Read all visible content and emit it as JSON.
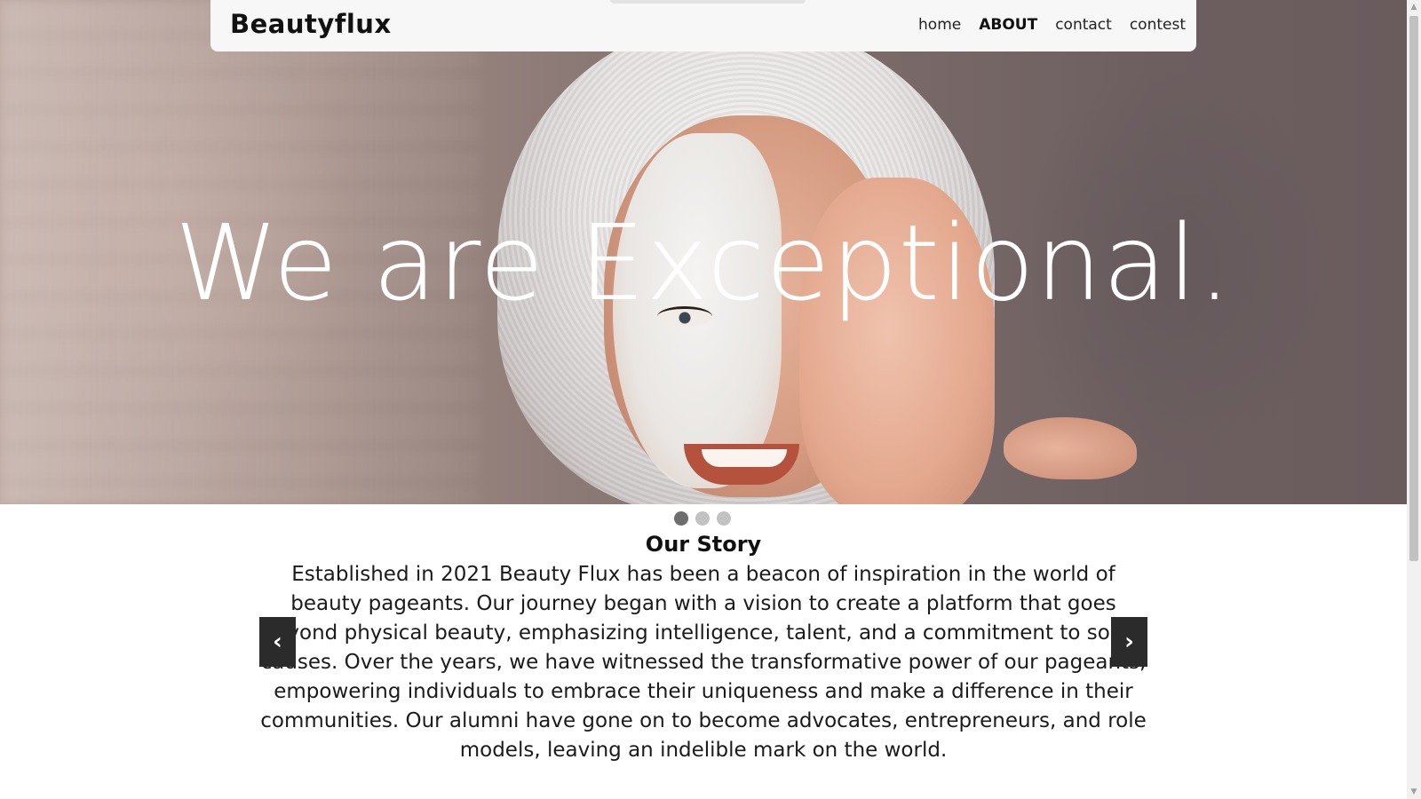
{
  "brand": {
    "name": "Beautyflux"
  },
  "nav": {
    "items": [
      {
        "label": "home",
        "active": false
      },
      {
        "label": "ABOUT",
        "active": true
      },
      {
        "label": "contact",
        "active": false
      },
      {
        "label": "contest",
        "active": false
      }
    ]
  },
  "hero": {
    "headline": "We are Exceptional."
  },
  "carousel": {
    "slide_count": 3,
    "active_index": 0,
    "prev_icon": "chevron-left-icon",
    "prev_glyph": "‹",
    "next_icon": "chevron-right-icon",
    "next_glyph": "›"
  },
  "story": {
    "title": "Our Story",
    "body": "Established in 2021 Beauty Flux has been a beacon of inspiration in the world of beauty pageants. Our journey began with a vision to create a platform that goes beyond physical beauty, emphasizing intelligence, talent, and a commitment to social causes. Over the years, we have witnessed the transformative power of our pageants, empowering individuals to embrace their uniqueness and make a difference in their communities. Our alumni have gone on to become advocates, entrepreneurs, and role models, leaving an indelible mark on the world."
  },
  "scrollbar": {
    "up_glyph": "▲",
    "down_glyph": "▼"
  },
  "colors": {
    "navbar_bg": "#f7f7f7",
    "text": "#111111",
    "control_bg": "#2b2b2b",
    "dot_active": "#6e6e6e",
    "dot_inactive": "#c2c2c2"
  }
}
